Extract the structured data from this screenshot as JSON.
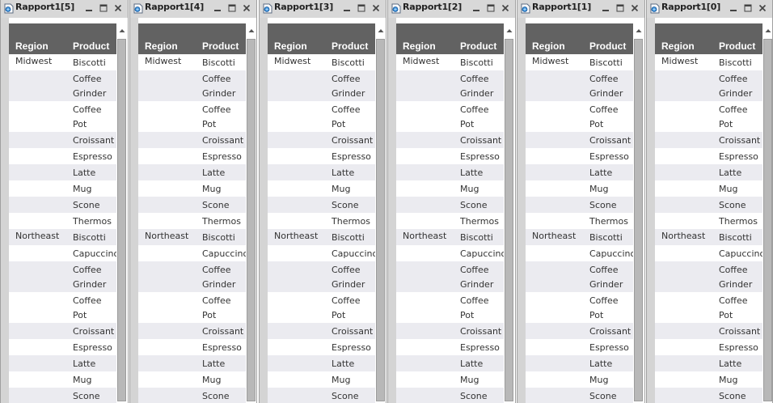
{
  "windows": [
    {
      "title": "Rapport1[5]"
    },
    {
      "title": "Rapport1[4]"
    },
    {
      "title": "Rapport1[3]"
    },
    {
      "title": "Rapport1[2]"
    },
    {
      "title": "Rapport1[1]"
    },
    {
      "title": "Rapport1[0]"
    }
  ],
  "table": {
    "headers": {
      "region": "Region",
      "product": "Product"
    },
    "rows": [
      {
        "region": "Midwest",
        "product": "Biscotti"
      },
      {
        "region": "",
        "product": "Coffee\nGrinder"
      },
      {
        "region": "",
        "product": "Coffee\nPot"
      },
      {
        "region": "",
        "product": "Croissant"
      },
      {
        "region": "",
        "product": "Espresso"
      },
      {
        "region": "",
        "product": "Latte"
      },
      {
        "region": "",
        "product": "Mug"
      },
      {
        "region": "",
        "product": "Scone"
      },
      {
        "region": "",
        "product": "Thermos"
      },
      {
        "region": "Northeast",
        "product": "Biscotti"
      },
      {
        "region": "",
        "product": "Capuccino"
      },
      {
        "region": "",
        "product": "Coffee\nGrinder"
      },
      {
        "region": "",
        "product": "Coffee\nPot"
      },
      {
        "region": "",
        "product": "Croissant"
      },
      {
        "region": "",
        "product": "Espresso"
      },
      {
        "region": "",
        "product": "Latte"
      },
      {
        "region": "",
        "product": "Mug"
      },
      {
        "region": "",
        "product": "Scone"
      }
    ]
  }
}
